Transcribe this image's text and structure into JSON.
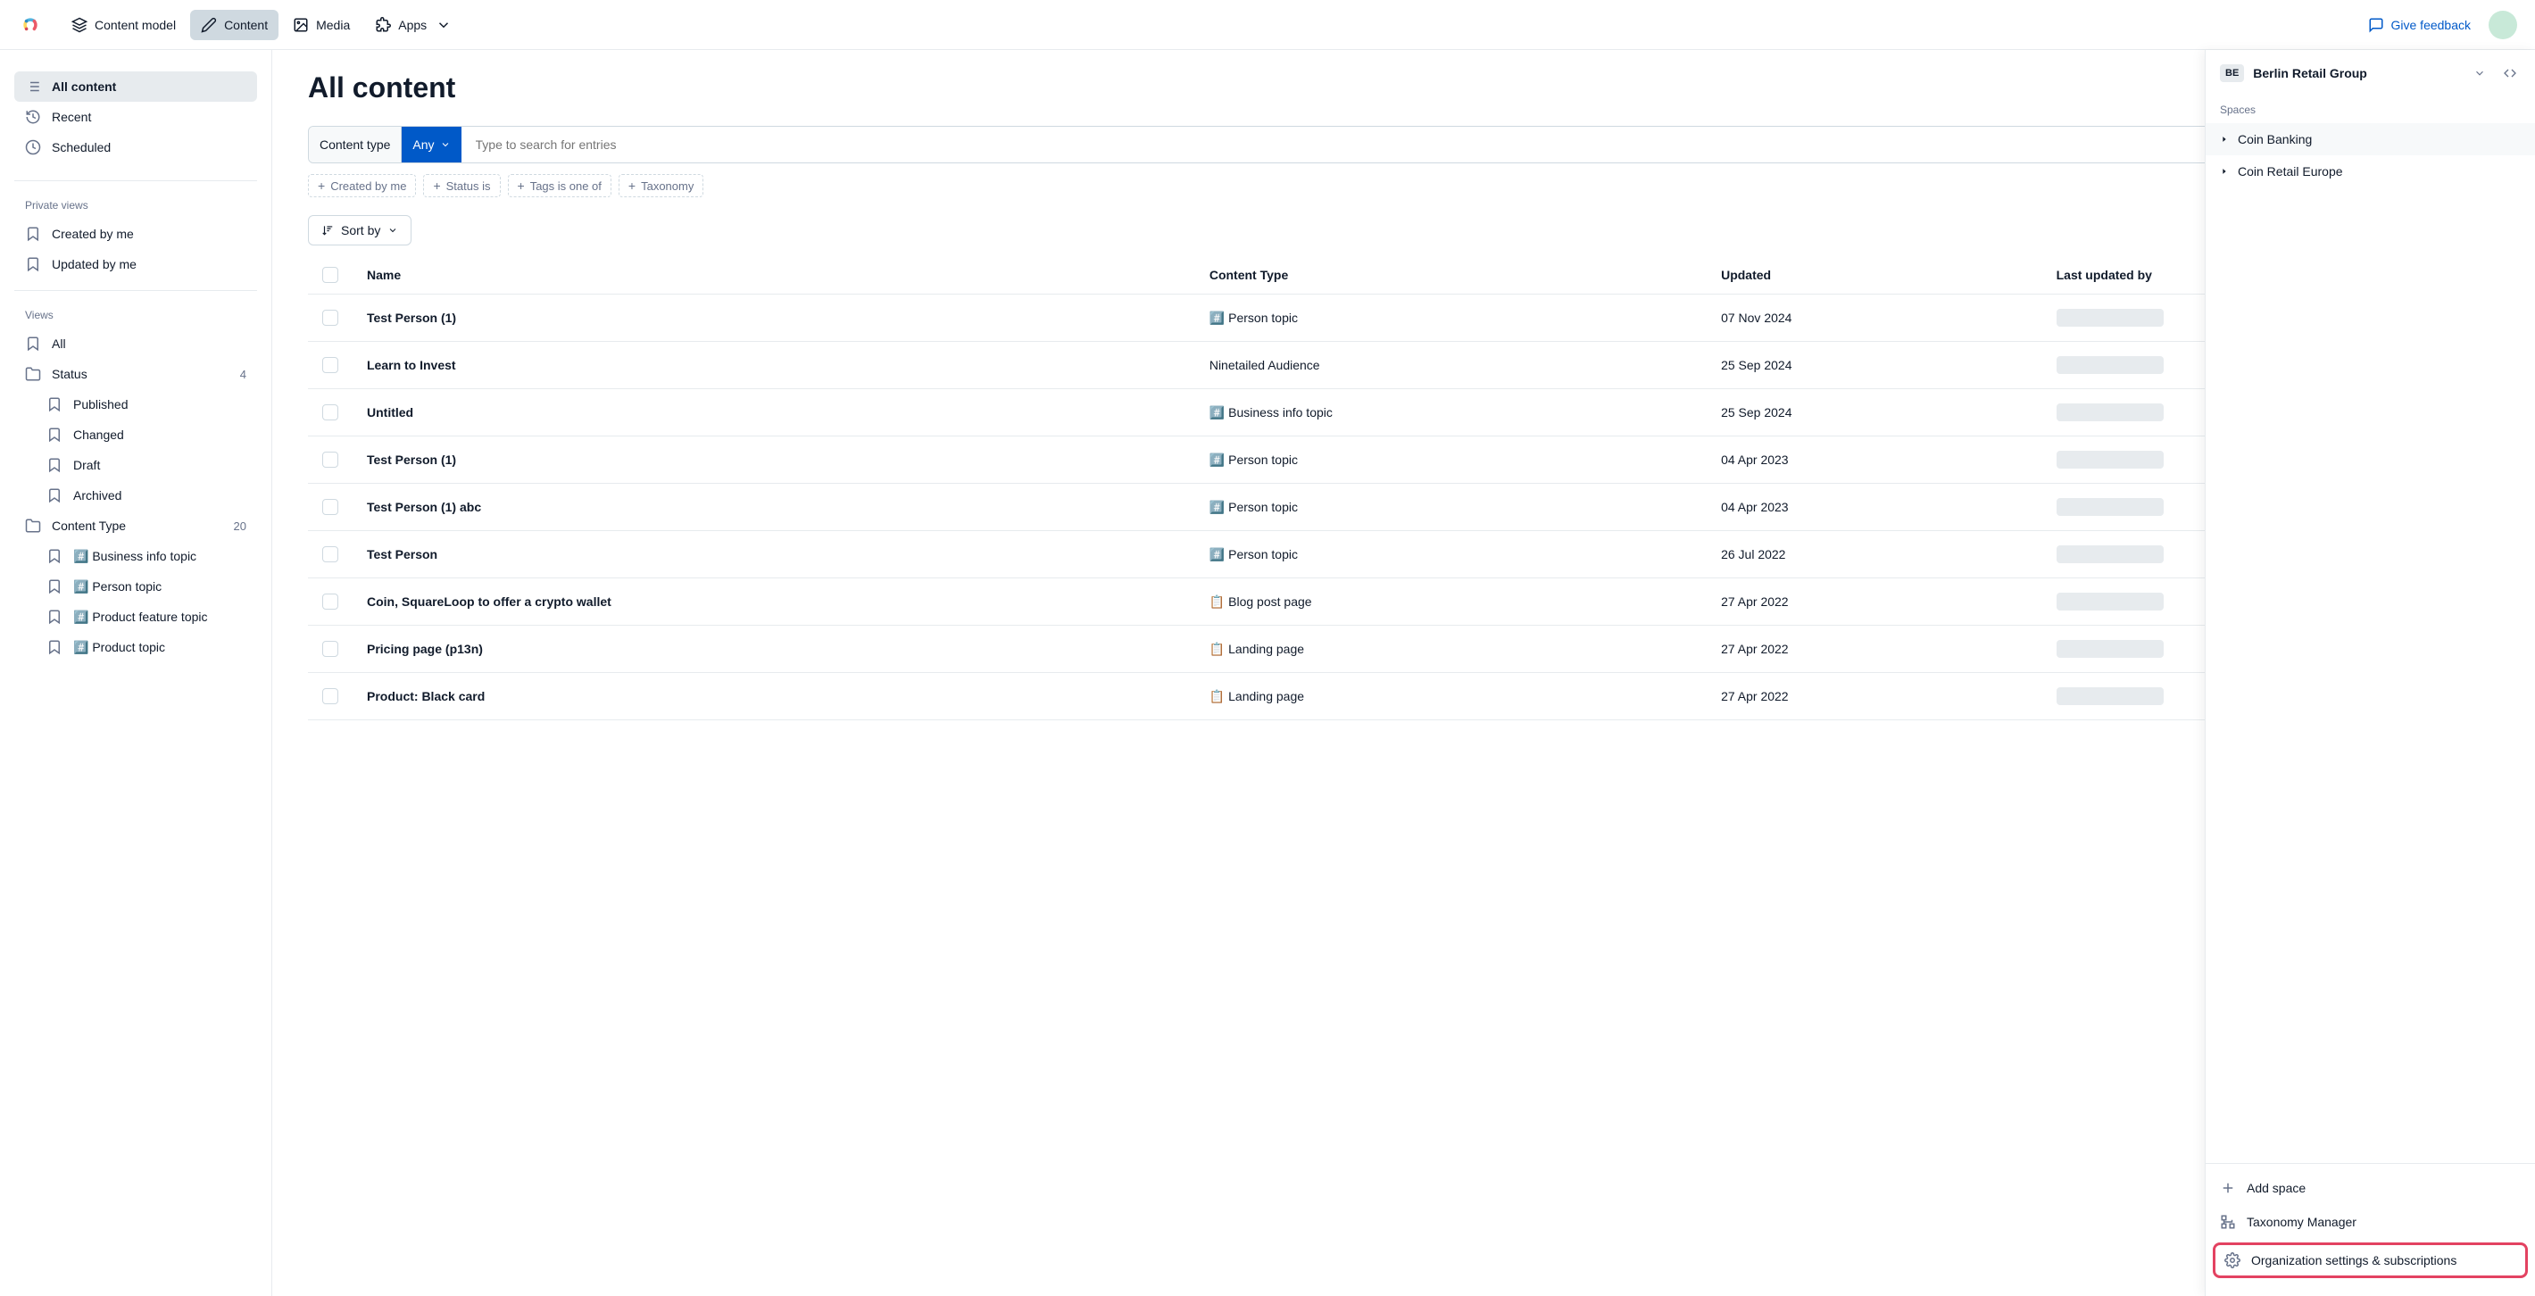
{
  "topnav": {
    "items": [
      "Content model",
      "Content",
      "Media",
      "Apps"
    ],
    "active_index": 1,
    "feedback": "Give feedback"
  },
  "org_panel": {
    "badge": "BE",
    "name": "Berlin Retail Group",
    "spaces_label": "Spaces",
    "spaces": [
      "Coin Banking",
      "Coin Retail Europe"
    ],
    "actions": {
      "add_space": "Add space",
      "taxonomy": "Taxonomy Manager",
      "org_settings": "Organization settings & subscriptions"
    }
  },
  "sidebar": {
    "primary": [
      {
        "label": "All content",
        "icon": "list"
      },
      {
        "label": "Recent",
        "icon": "history"
      },
      {
        "label": "Scheduled",
        "icon": "clock"
      }
    ],
    "private_views_heading": "Private views",
    "private_views": [
      {
        "label": "Created by me",
        "icon": "bookmark"
      },
      {
        "label": "Updated by me",
        "icon": "bookmark"
      }
    ],
    "views_heading": "Views",
    "views": [
      {
        "label": "All",
        "icon": "bookmark"
      },
      {
        "label": "Status",
        "icon": "folder",
        "count": "4",
        "children": [
          "Published",
          "Changed",
          "Draft",
          "Archived"
        ]
      },
      {
        "label": "Content Type",
        "icon": "folder",
        "count": "20",
        "children": [
          "#️⃣ Business info topic",
          "#️⃣ Person topic",
          "#️⃣ Product feature topic",
          "#️⃣ Product topic"
        ]
      }
    ]
  },
  "page": {
    "title": "All content",
    "content_type_label": "Content type",
    "any_label": "Any",
    "search_placeholder": "Type to search for entries",
    "chips": [
      "Created by me",
      "Status is",
      "Tags is one of",
      "Taxonomy"
    ],
    "sort_label": "Sort by"
  },
  "table": {
    "headers": [
      "Name",
      "Content Type",
      "Updated",
      "Last updated by"
    ],
    "rows": [
      {
        "name": "Test Person (1)",
        "type": "#️⃣ Person topic",
        "updated": "07 Nov 2024"
      },
      {
        "name": "Learn to Invest",
        "type": "Ninetailed Audience",
        "updated": "25 Sep 2024"
      },
      {
        "name": "Untitled",
        "type": "#️⃣ Business info topic",
        "updated": "25 Sep 2024"
      },
      {
        "name": "Test Person (1)",
        "type": "#️⃣ Person topic",
        "updated": "04 Apr 2023"
      },
      {
        "name": "Test Person (1) abc",
        "type": "#️⃣ Person topic",
        "updated": "04 Apr 2023"
      },
      {
        "name": "Test Person",
        "type": "#️⃣ Person topic",
        "updated": "26 Jul 2022"
      },
      {
        "name": "Coin, SquareLoop to offer a crypto wallet",
        "type": "📋 Blog post page",
        "updated": "27 Apr 2022"
      },
      {
        "name": "Pricing page (p13n)",
        "type": "📋 Landing page",
        "updated": "27 Apr 2022"
      },
      {
        "name": "Product: Black card",
        "type": "📋 Landing page",
        "updated": "27 Apr 2022"
      }
    ]
  }
}
